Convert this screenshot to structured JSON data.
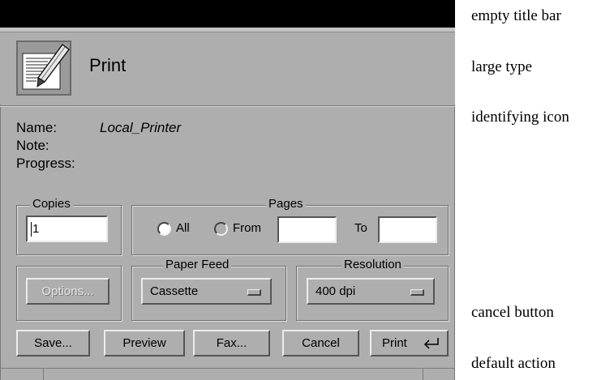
{
  "dialog": {
    "title": "Print",
    "info": {
      "name_label": "Name:",
      "name_value": "Local_Printer",
      "note_label": "Note:",
      "progress_label": "Progress:"
    },
    "copies": {
      "legend": "Copies",
      "value": "1"
    },
    "pages": {
      "legend": "Pages",
      "all_label": "All",
      "from_label": "From",
      "to_label": "To",
      "selected": "All",
      "from_value": "",
      "to_value": ""
    },
    "options_label": "Options...",
    "paper_feed": {
      "legend": "Paper Feed",
      "value": "Cassette"
    },
    "resolution": {
      "legend": "Resolution",
      "value": "400 dpi"
    },
    "buttons": {
      "save": "Save...",
      "preview": "Preview",
      "fax": "Fax...",
      "cancel": "Cancel",
      "print": "Print"
    }
  },
  "callouts": {
    "title_bar": "empty title bar",
    "large_type": "large type",
    "icon": "identifying icon",
    "cancel": "cancel button",
    "default": "default action"
  },
  "icons": {
    "header": "print-document-icon",
    "default_button": "return-key-icon"
  },
  "colors": {
    "dialog_bg": "#aeaeae",
    "title_bar": "#000000"
  }
}
